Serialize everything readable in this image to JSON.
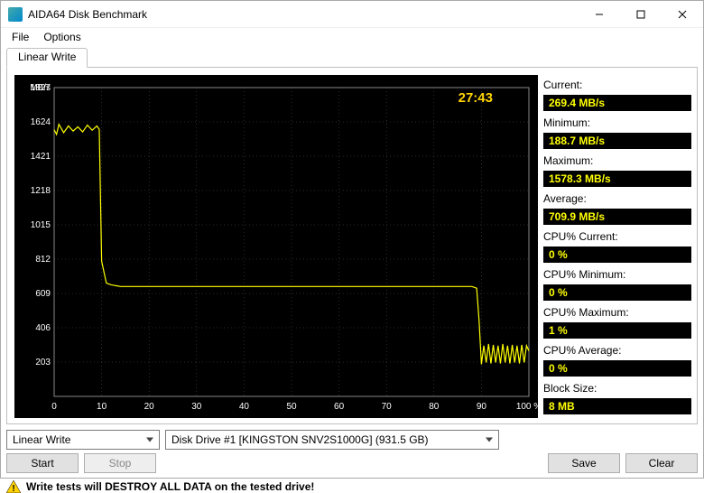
{
  "window": {
    "title": "AIDA64 Disk Benchmark"
  },
  "menu": {
    "file": "File",
    "options": "Options"
  },
  "tabs": {
    "active": "Linear Write"
  },
  "chart_data": {
    "type": "line",
    "xlabel": "",
    "ylabel": "MB/s",
    "xlim": [
      0,
      100
    ],
    "ylim": [
      0,
      1827
    ],
    "x_ticks": [
      0,
      10,
      20,
      30,
      40,
      50,
      60,
      70,
      80,
      90,
      100
    ],
    "x_tick_suffix_last": "100 %",
    "y_ticks": [
      203,
      406,
      609,
      812,
      1015,
      1218,
      1421,
      1624,
      1827
    ],
    "timer": "27:43",
    "series": [
      {
        "name": "Linear Write",
        "color": "#ffff00",
        "x": [
          0,
          0.5,
          1,
          2,
          3,
          4,
          5,
          6,
          7,
          8,
          9,
          9.5,
          10,
          11,
          12,
          13,
          14,
          20,
          30,
          40,
          50,
          60,
          70,
          80,
          88,
          89,
          89.5,
          90,
          90.5,
          91,
          91.5,
          92,
          92.5,
          93,
          93.5,
          94,
          94.5,
          95,
          95.5,
          96,
          96.5,
          97,
          97.5,
          98,
          98.5,
          99,
          99.5,
          100
        ],
        "values": [
          1578,
          1550,
          1610,
          1560,
          1600,
          1570,
          1595,
          1565,
          1605,
          1575,
          1600,
          1580,
          800,
          670,
          660,
          655,
          650,
          650,
          650,
          650,
          650,
          650,
          650,
          650,
          650,
          640,
          450,
          190,
          300,
          200,
          310,
          195,
          305,
          200,
          300,
          195,
          310,
          200,
          300,
          195,
          305,
          200,
          300,
          195,
          305,
          200,
          300,
          269
        ]
      }
    ]
  },
  "stats": {
    "current_label": "Current:",
    "current": "269.4 MB/s",
    "minimum_label": "Minimum:",
    "minimum": "188.7 MB/s",
    "maximum_label": "Maximum:",
    "maximum": "1578.3 MB/s",
    "average_label": "Average:",
    "average": "709.9 MB/s",
    "cpu_cur_label": "CPU% Current:",
    "cpu_cur": "0 %",
    "cpu_min_label": "CPU% Minimum:",
    "cpu_min": "0 %",
    "cpu_max_label": "CPU% Maximum:",
    "cpu_max": "1 %",
    "cpu_avg_label": "CPU% Average:",
    "cpu_avg": "0 %",
    "block_label": "Block Size:",
    "block": "8 MB"
  },
  "controls": {
    "test_select": "Linear Write",
    "drive_select": "Disk Drive #1  [KINGSTON SNV2S1000G]  (931.5 GB)",
    "start": "Start",
    "stop": "Stop",
    "save": "Save",
    "clear": "Clear"
  },
  "warning": "Write tests will DESTROY ALL DATA on the tested drive!"
}
